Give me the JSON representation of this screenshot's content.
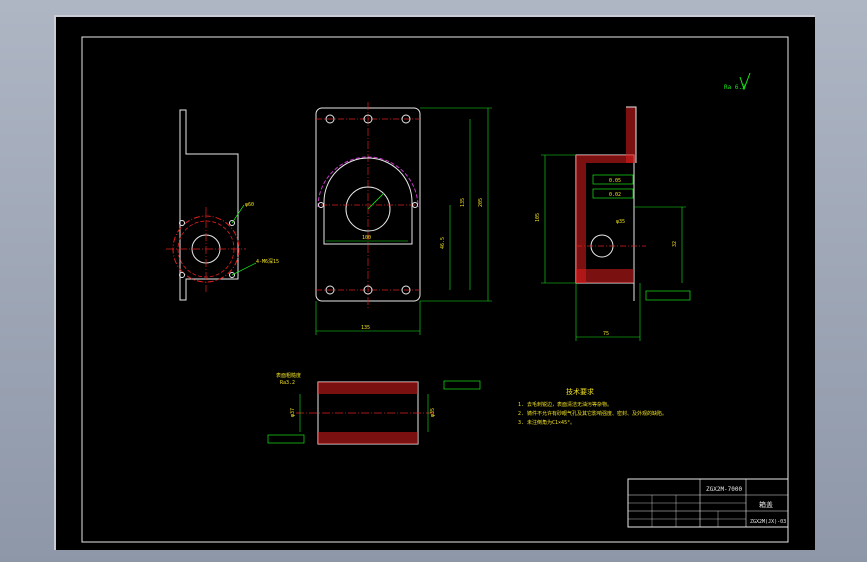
{
  "drawing": {
    "roughness": "Ra 6.3",
    "technical_requirements": {
      "title": "技术要求",
      "items": [
        "1. 去毛刺锐边，表面清洁无油污等杂物。",
        "2. 铸件不允许有砂眼气孔及其它影响强度、密封、及外观的缺陷。",
        "3. 未注倒角为C1×45°。"
      ]
    },
    "title_block": {
      "project_code": "ZGX2M-7000",
      "part_name": "箱盖",
      "drawing_number": "ZGX2M(JX)-03"
    },
    "front_view_dims": {
      "width_bottom": "135",
      "inner_width": "100",
      "height_inner": "135",
      "height_outer": "205",
      "hole_offset": "46.5"
    },
    "side_view_dims": {
      "depth": "75",
      "height": "105",
      "bore": "φ35",
      "height2": "32"
    },
    "section_dims": {
      "left_label": "表面粗糙度",
      "ra_label": "Ra3.2",
      "diam": "φ37",
      "diam2": "φ35"
    },
    "left_view_dims": {
      "hole_label": "4-M6深15",
      "bolt_circle": "φ60"
    },
    "tolerance_frames": [
      "0.05",
      "0.02"
    ]
  }
}
